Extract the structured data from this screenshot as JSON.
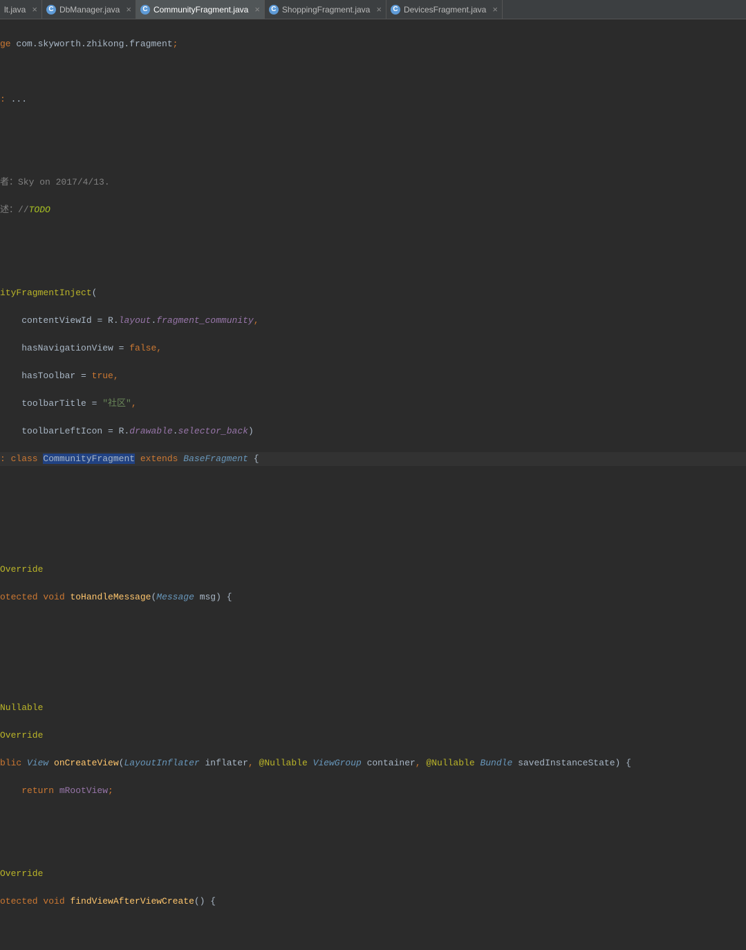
{
  "tabs": [
    {
      "icon": "",
      "label": "lt.java",
      "active": false
    },
    {
      "icon": "C",
      "label": "DbManager.java",
      "active": false
    },
    {
      "icon": "C",
      "label": "CommunityFragment.java",
      "active": true
    },
    {
      "icon": "C",
      "label": "ShoppingFragment.java",
      "active": false
    },
    {
      "icon": "C",
      "label": "DevicesFragment.java",
      "active": false
    }
  ],
  "close_glyph": "×",
  "code": {
    "pkg_kw": "ge",
    "pkg_name": " com.skyworth.zhikong.fragment",
    "semi": ";",
    "import_kw": ": ",
    "import_dots": "...",
    "author_line": "者：Sky on 2017/4/13.",
    "todo_prefix": "述：",
    "todo_slashes": "//",
    "todo_text": "TODO",
    "inject": "ityFragmentInject",
    "open_paren": "(",
    "p1_name": "contentViewId",
    "eq": " = ",
    "r": "R",
    "layout": "layout",
    "frag_comm": "fragment_community",
    "comma": ",",
    "p2_name": "hasNavigationView",
    "false": "false",
    "p3_name": "hasToolbar",
    "true": "true",
    "p4_name": "toolbarTitle",
    "title_str": "\"社区\"",
    "p5_name": "toolbarLeftIcon",
    "drawable": "drawable",
    "sel_back": "selector_back",
    "close_paren": ")",
    "class_kw": ": class ",
    "class_name": "CommunityFragment",
    "extends_kw": " extends ",
    "base": "BaseFragment",
    "open_brace": " {",
    "override": "Override",
    "protected": "otected ",
    "void": "void ",
    "public": "blic ",
    "tohandle": "toHandleMessage",
    "message": "Message",
    "msg": " msg",
    "nullable": "Nullable",
    "nullable_ann": "@Nullable",
    "view": "View ",
    "oncreate": "onCreateView",
    "layoutinf": "LayoutInflater",
    "inflater": " inflater",
    "viewgroup": "ViewGroup",
    "container": " container",
    "bundle": "Bundle",
    "saved": " savedInstanceState",
    "return": "return ",
    "mroot": "mRootView",
    "findview": "findViewAfterViewCreate",
    "empty_parens": "()"
  }
}
